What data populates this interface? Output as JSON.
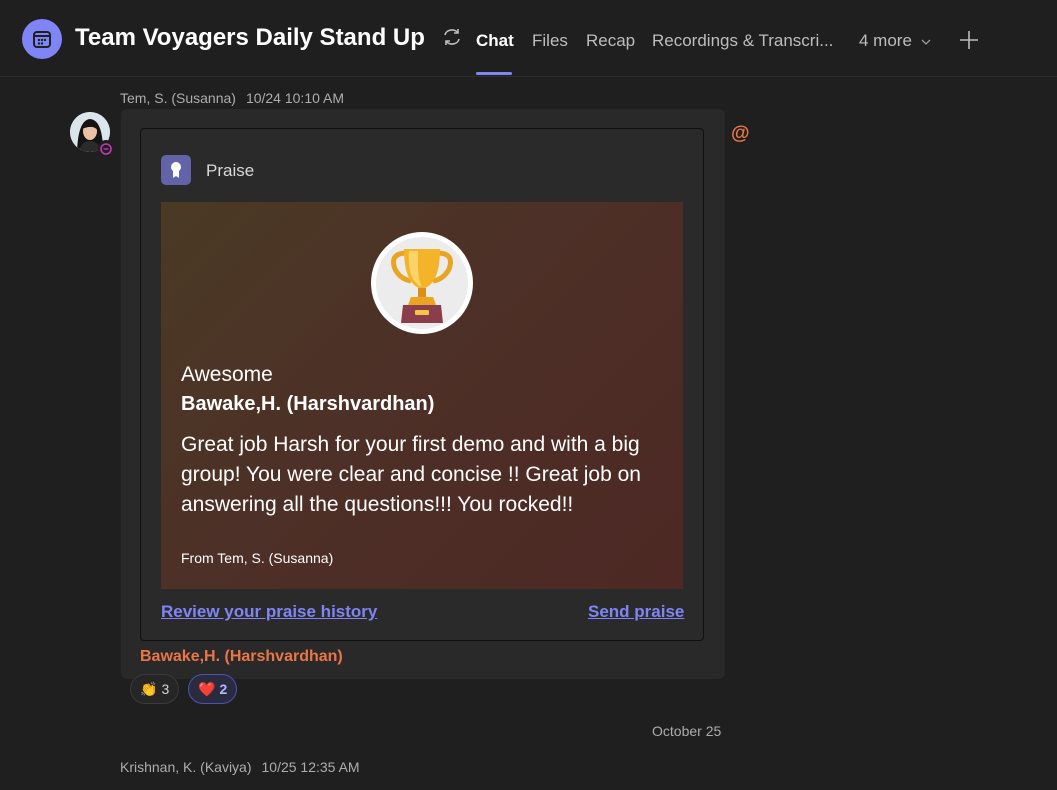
{
  "header": {
    "title": "Team Voyagers Daily Stand Up",
    "tabs": [
      {
        "label": "Chat",
        "active": true
      },
      {
        "label": "Files"
      },
      {
        "label": "Recap"
      },
      {
        "label": "Recordings & Transcri..."
      },
      {
        "label": "4 more"
      }
    ]
  },
  "message1": {
    "sender": "Tem, S. (Susanna)",
    "timestamp": "10/24 10:10 AM",
    "card": {
      "header": "Praise",
      "type": "Awesome",
      "recipient": "Bawake,H. (Harshvardhan)",
      "body": "Great job Harsh for your first demo and with a big group! You were clear and concise !! Great job on answering all the questions!!! You rocked!!",
      "from": "From Tem, S. (Susanna)",
      "review_link": "Review your praise history",
      "send_link": "Send praise"
    },
    "mention": "Bawake,H. (Harshvardhan)",
    "reactions": [
      {
        "emoji": "👏",
        "count": "3"
      },
      {
        "emoji": "❤️",
        "count": "2"
      }
    ]
  },
  "divider": {
    "date": "October 25"
  },
  "message2": {
    "sender": "Krishnan, K. (Kaviya)",
    "timestamp": "10/25 12:35 AM"
  },
  "colors": {
    "accent": "#7f85f5",
    "mention": "#e97548",
    "background": "#1f1f1f"
  }
}
